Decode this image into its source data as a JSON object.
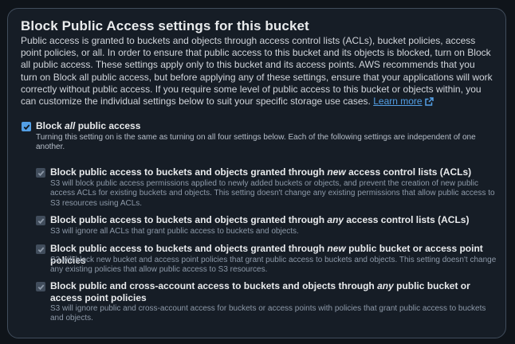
{
  "panel": {
    "title": "Block Public Access settings for this bucket",
    "description": "Public access is granted to buckets and objects through access control lists (ACLs), bucket policies, access point policies, or all. In order to ensure that public access to this bucket and its objects is blocked, turn on Block all public access. These settings apply only to this bucket and its access points. AWS recommends that you turn on Block all public access, but before applying any of these settings, ensure that your applications will work correctly without public access. If you require some level of public access to this bucket or objects within, you can customize the individual settings below to suit your specific storage use cases.",
    "learn_more": "Learn more",
    "learn_more_icon": "external-link-icon"
  },
  "block_all": {
    "checked": true,
    "label_prefix": "Block ",
    "label_emphasis": "all",
    "label_suffix": " public access",
    "description": "Turning this setting on is the same as turning on all four settings below. Each of the following settings are independent of one another."
  },
  "options": [
    {
      "checked": true,
      "disabled": true,
      "label_prefix": "Block public access to buckets and objects granted through ",
      "label_emphasis": "new",
      "label_suffix": " access control lists (ACLs)",
      "description": "S3 will block public access permissions applied to newly added buckets or objects, and prevent the creation of new public access ACLs for existing buckets and objects. This setting doesn't change any existing permissions that allow public access to S3 resources using ACLs."
    },
    {
      "checked": true,
      "disabled": true,
      "label_prefix": "Block public access to buckets and objects granted through ",
      "label_emphasis": "any",
      "label_suffix": " access control lists (ACLs)",
      "description": "S3 will ignore all ACLs that grant public access to buckets and objects."
    },
    {
      "checked": true,
      "disabled": true,
      "label_prefix": "Block public access to buckets and objects granted through ",
      "label_emphasis": "new",
      "label_suffix": " public bucket or access point policies",
      "description": "S3 will block new bucket and access point policies that grant public access to buckets and objects. This setting doesn't change any existing policies that allow public access to S3 resources."
    },
    {
      "checked": true,
      "disabled": true,
      "label_prefix": "Block public and cross-account access to buckets and objects through ",
      "label_emphasis": "any",
      "label_suffix": " public bucket or access point policies",
      "description": "S3 will ignore public and cross-account access for buckets or access points with policies that grant public access to buckets and objects."
    }
  ],
  "colors": {
    "checkbox_checked": "#539fe5",
    "checkbox_disabled": "#414d5c",
    "link": "#539fe5"
  },
  "icons": {
    "checkmark": "checkmark-icon"
  }
}
